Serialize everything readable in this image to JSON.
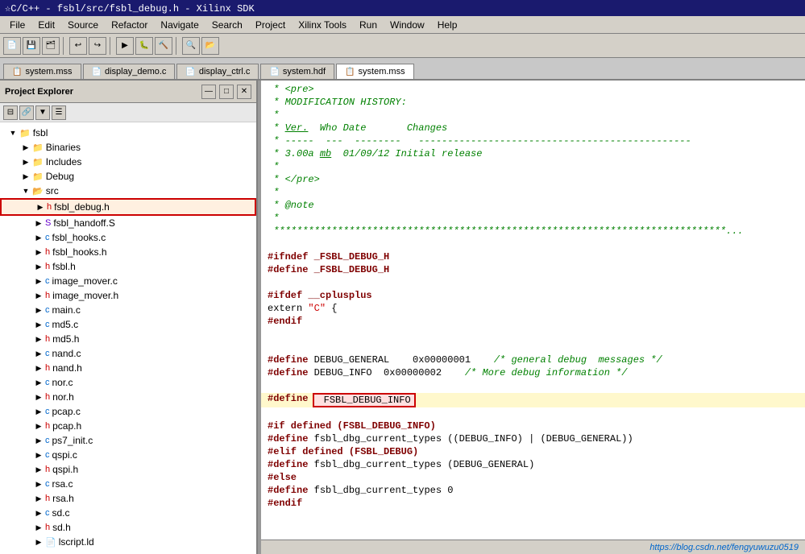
{
  "titleBar": {
    "text": "☆C/C++ - fsbl/src/fsbl_debug.h - Xilinx SDK"
  },
  "menuBar": {
    "items": [
      "File",
      "Edit",
      "Source",
      "Refactor",
      "Navigate",
      "Search",
      "Project",
      "Xilinx Tools",
      "Run",
      "Window",
      "Help"
    ]
  },
  "tabs": [
    {
      "label": "system.mss",
      "icon": "📄",
      "active": false
    },
    {
      "label": "display_demo.c",
      "icon": "📄",
      "active": false
    },
    {
      "label": "display_ctrl.c",
      "icon": "📄",
      "active": false
    },
    {
      "label": "system.hdf",
      "icon": "📄",
      "active": false
    },
    {
      "label": "system.mss",
      "icon": "📄",
      "active": true
    }
  ],
  "explorer": {
    "title": "Project Explorer",
    "badge": "✕"
  },
  "tree": {
    "items": [
      {
        "id": "fsbl",
        "label": "fsbl",
        "level": 1,
        "expanded": true,
        "type": "folder",
        "icon": "📁"
      },
      {
        "id": "binaries",
        "label": "Binaries",
        "level": 2,
        "expanded": false,
        "type": "folder",
        "icon": "📁"
      },
      {
        "id": "includes",
        "label": "Includes",
        "level": 2,
        "expanded": false,
        "type": "folder",
        "icon": "📁"
      },
      {
        "id": "debug",
        "label": "Debug",
        "level": 2,
        "expanded": false,
        "type": "folder",
        "icon": "📁"
      },
      {
        "id": "src",
        "label": "src",
        "level": 2,
        "expanded": true,
        "type": "folder",
        "icon": "📂"
      },
      {
        "id": "fsbl_debug_h",
        "label": "fsbl_debug.h",
        "level": 3,
        "expanded": false,
        "type": "h-file",
        "highlighted": true
      },
      {
        "id": "fsbl_handoff_s",
        "label": "fsbl_handoff.S",
        "level": 3,
        "expanded": false,
        "type": "s-file"
      },
      {
        "id": "fsbl_hooks_c",
        "label": "fsbl_hooks.c",
        "level": 3,
        "expanded": false,
        "type": "c-file"
      },
      {
        "id": "fsbl_hooks_h",
        "label": "fsbl_hooks.h",
        "level": 3,
        "expanded": false,
        "type": "h-file"
      },
      {
        "id": "fsbl_h",
        "label": "fsbl.h",
        "level": 3,
        "expanded": false,
        "type": "h-file"
      },
      {
        "id": "image_mover_c",
        "label": "image_mover.c",
        "level": 3,
        "expanded": false,
        "type": "c-file"
      },
      {
        "id": "image_mover_h",
        "label": "image_mover.h",
        "level": 3,
        "expanded": false,
        "type": "h-file"
      },
      {
        "id": "main_c",
        "label": "main.c",
        "level": 3,
        "expanded": false,
        "type": "c-file"
      },
      {
        "id": "md5_c",
        "label": "md5.c",
        "level": 3,
        "expanded": false,
        "type": "c-file"
      },
      {
        "id": "md5_h",
        "label": "md5.h",
        "level": 3,
        "expanded": false,
        "type": "h-file"
      },
      {
        "id": "nand_c",
        "label": "nand.c",
        "level": 3,
        "expanded": false,
        "type": "c-file"
      },
      {
        "id": "nand_h",
        "label": "nand.h",
        "level": 3,
        "expanded": false,
        "type": "h-file"
      },
      {
        "id": "nor_c",
        "label": "nor.c",
        "level": 3,
        "expanded": false,
        "type": "c-file"
      },
      {
        "id": "nor_h",
        "label": "nor.h",
        "level": 3,
        "expanded": false,
        "type": "h-file"
      },
      {
        "id": "pcap_c",
        "label": "pcap.c",
        "level": 3,
        "expanded": false,
        "type": "c-file"
      },
      {
        "id": "pcap_h",
        "label": "pcap.h",
        "level": 3,
        "expanded": false,
        "type": "h-file"
      },
      {
        "id": "ps7_init_c",
        "label": "ps7_init.c",
        "level": 3,
        "expanded": false,
        "type": "c-file"
      },
      {
        "id": "qspi_c",
        "label": "qspi.c",
        "level": 3,
        "expanded": false,
        "type": "c-file"
      },
      {
        "id": "qspi_h",
        "label": "qspi.h",
        "level": 3,
        "expanded": false,
        "type": "h-file"
      },
      {
        "id": "rsa_c",
        "label": "rsa.c",
        "level": 3,
        "expanded": false,
        "type": "c-file"
      },
      {
        "id": "rsa_h",
        "label": "rsa.h",
        "level": 3,
        "expanded": false,
        "type": "h-file"
      },
      {
        "id": "sd_c",
        "label": "sd.c",
        "level": 3,
        "expanded": false,
        "type": "c-file"
      },
      {
        "id": "sd_h",
        "label": "sd.h",
        "level": 3,
        "expanded": false,
        "type": "h-file"
      },
      {
        "id": "lscript_ld",
        "label": "lscript.ld",
        "level": 3,
        "expanded": false,
        "type": "ld-file"
      }
    ]
  },
  "code": {
    "lines": [
      {
        "type": "comment",
        "text": " * <pre>"
      },
      {
        "type": "comment",
        "text": " * MODIFICATION HISTORY:"
      },
      {
        "type": "comment",
        "text": " *"
      },
      {
        "type": "comment",
        "text": " * Ver.  Who Date       Changes"
      },
      {
        "type": "comment",
        "text": " * ----- --- --------   -----------------------------------------------"
      },
      {
        "type": "comment",
        "text": " * 3.00a mb  01/09/12 Initial release"
      },
      {
        "type": "comment",
        "text": " *"
      },
      {
        "type": "comment",
        "text": " * </pre>"
      },
      {
        "type": "comment",
        "text": " *"
      },
      {
        "type": "comment",
        "text": " * @note"
      },
      {
        "type": "comment",
        "text": " *"
      },
      {
        "type": "separator",
        "text": " ******************************************************************************..."
      },
      {
        "type": "empty",
        "text": ""
      },
      {
        "type": "preprocessor",
        "text": "#ifndef _FSBL_DEBUG_H"
      },
      {
        "type": "preprocessor",
        "text": "#define _FSBL_DEBUG_H"
      },
      {
        "type": "empty",
        "text": ""
      },
      {
        "type": "preprocessor",
        "text": "#ifdef __cplusplus"
      },
      {
        "type": "code",
        "text": "extern \"C\" {"
      },
      {
        "type": "preprocessor",
        "text": "#endif"
      },
      {
        "type": "empty",
        "text": ""
      },
      {
        "type": "empty",
        "text": ""
      },
      {
        "type": "define-comment",
        "text": "#define DEBUG_GENERAL    0x00000001    /* general debug  messages */"
      },
      {
        "type": "define-comment",
        "text": "#define DEBUG_INFO  0x00000002    /* More debug information */"
      },
      {
        "type": "empty",
        "text": ""
      },
      {
        "type": "highlighted-define",
        "text": "#define FSBL_DEBUG_INFO"
      },
      {
        "type": "empty",
        "text": ""
      },
      {
        "type": "preprocessor",
        "text": "#if defined (FSBL_DEBUG_INFO)"
      },
      {
        "type": "define2",
        "text": "#define fsbl_dbg_current_types ((DEBUG_INFO) | (DEBUG_GENERAL))"
      },
      {
        "type": "preprocessor",
        "text": "#elif defined (FSBL_DEBUG)"
      },
      {
        "type": "define2",
        "text": "#define fsbl_dbg_current_types (DEBUG_GENERAL)"
      },
      {
        "type": "preprocessor",
        "text": "#else"
      },
      {
        "type": "define2",
        "text": "#define fsbl_dbg_current_types 0"
      },
      {
        "type": "preprocessor",
        "text": "#endif"
      }
    ]
  },
  "statusBar": {
    "watermark": "https://blog.csdn.net/fengyuwuzu0519"
  }
}
